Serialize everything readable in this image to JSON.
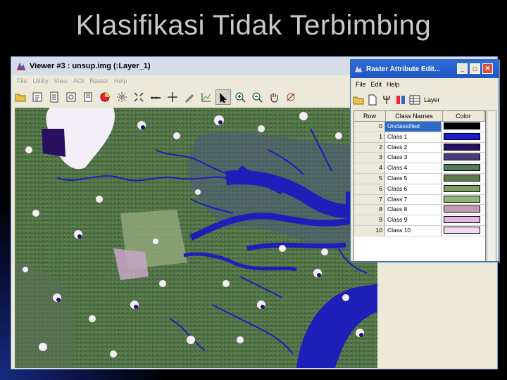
{
  "slide": {
    "title": "Klasifikasi Tidak Terbimbing"
  },
  "viewer": {
    "title": "Viewer #3 : unsup.img (:Layer_1)",
    "menu": [
      "File",
      "Utility",
      "View",
      "AOI",
      "Raster",
      "Help"
    ],
    "toolbar_icons": [
      "open-folder-icon",
      "layer-info-icon",
      "print-icon",
      "zoom-box-icon",
      "magnify-icon",
      "pie-icon",
      "roam-icon",
      "scale-icon",
      "ruler-icon",
      "crosshair-icon",
      "edit-icon",
      "profile-icon",
      "arrow-select-icon",
      "zoom-in-icon",
      "zoom-out-icon",
      "pan-hand-icon",
      "link-icon"
    ],
    "active_tool": "arrow-select-icon"
  },
  "attribute_editor": {
    "title": "Raster Attribute Edit...",
    "menu": [
      "File",
      "Edit",
      "Help"
    ],
    "toolbar_icons": [
      "open-folder-icon",
      "page-icon",
      "fork-icon",
      "columns-icon",
      "table-icon"
    ],
    "layer_label": "Layer",
    "columns": {
      "row": "Row",
      "name": "Class Names",
      "color": "Color"
    },
    "rows": [
      {
        "row": "0",
        "name": "Unclassified",
        "color": "#000000"
      },
      {
        "row": "1",
        "name": "Class 1",
        "color": "#1a1ad0"
      },
      {
        "row": "2",
        "name": "Class 2",
        "color": "#2a1060"
      },
      {
        "row": "3",
        "name": "Class 3",
        "color": "#4a3a78"
      },
      {
        "row": "4",
        "name": "Class 4",
        "color": "#4f7a5c"
      },
      {
        "row": "5",
        "name": "Class 5",
        "color": "#5a7a48"
      },
      {
        "row": "6",
        "name": "Class 6",
        "color": "#7aa062"
      },
      {
        "row": "7",
        "name": "Class 7",
        "color": "#93b37a"
      },
      {
        "row": "8",
        "name": "Class 8",
        "color": "#c89ab8"
      },
      {
        "row": "9",
        "name": "Class 9",
        "color": "#e8b4e0"
      },
      {
        "row": "10",
        "name": "Class 10",
        "color": "#f6d8f4"
      }
    ]
  },
  "colors": {
    "water": "#1e1eb8",
    "forest": "#4f7046",
    "cloud": "#f3eef7"
  }
}
